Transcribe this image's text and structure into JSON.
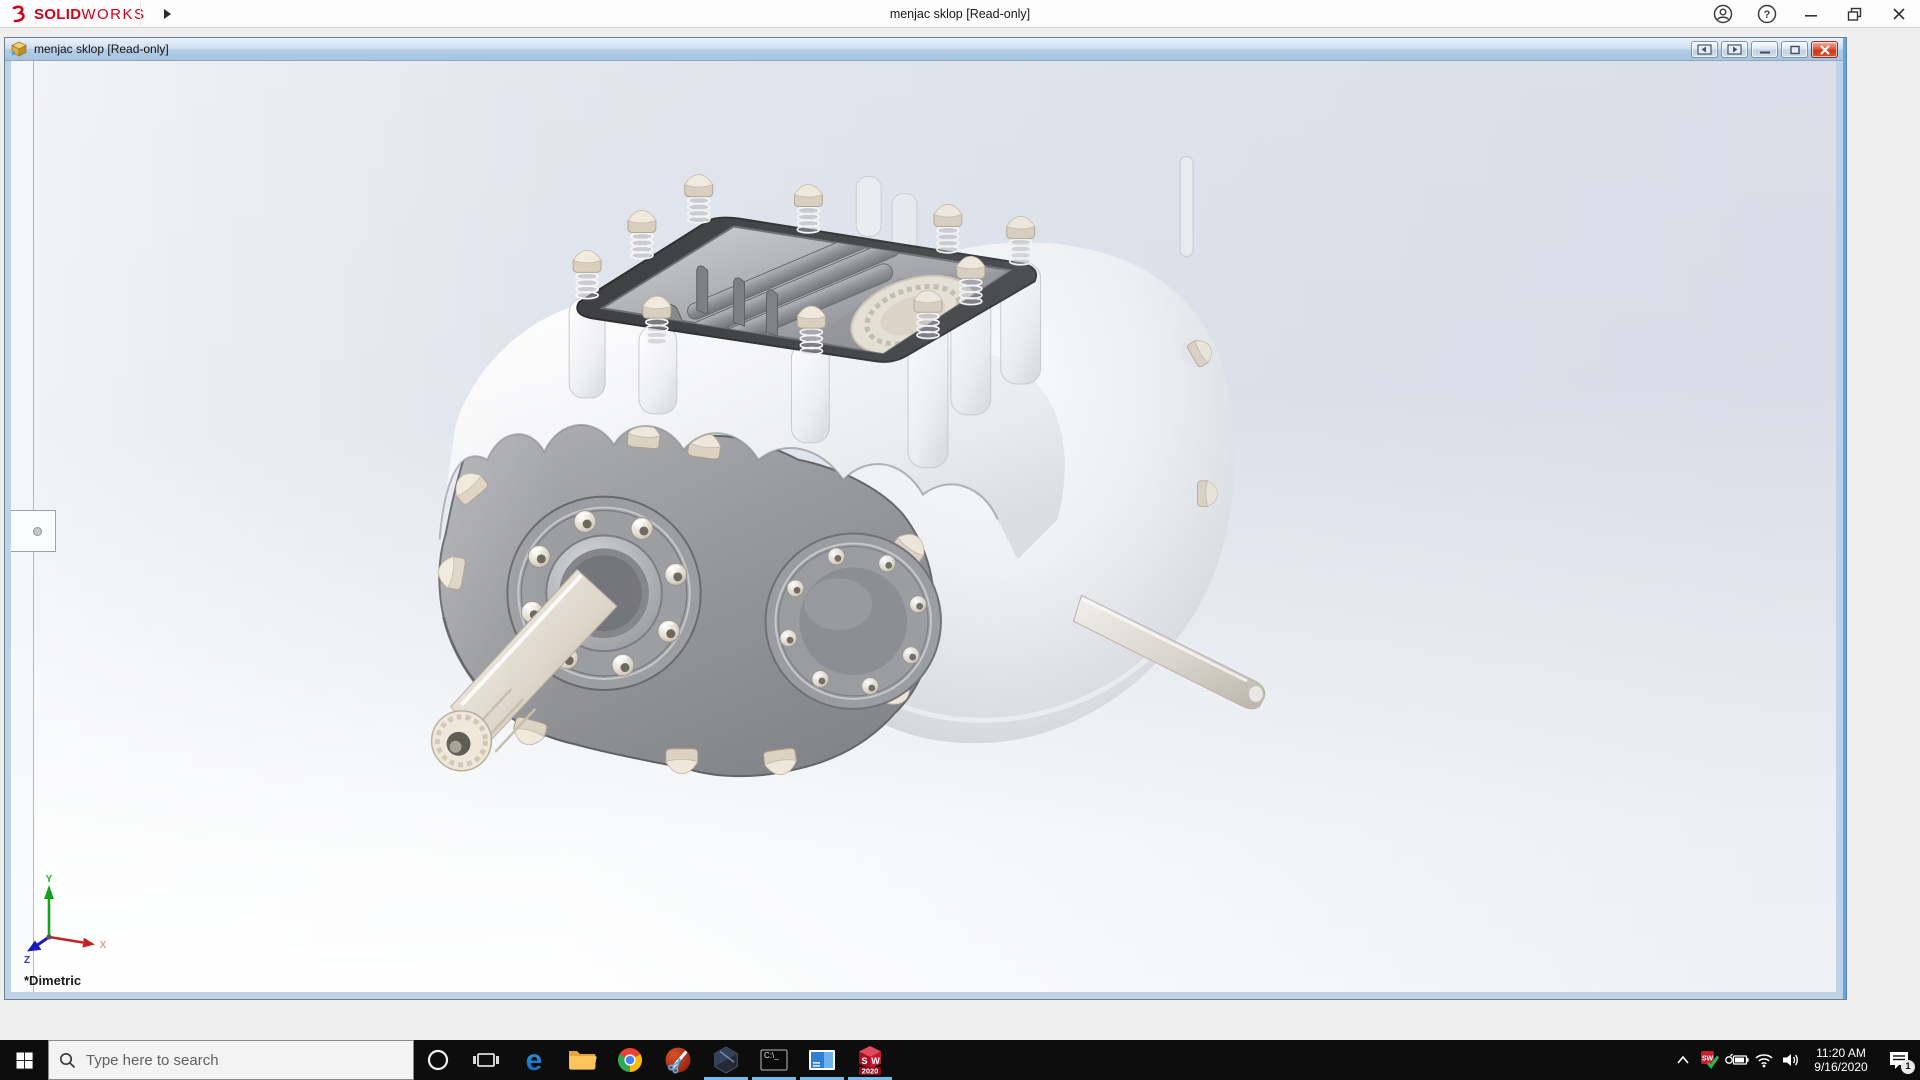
{
  "app": {
    "title": "menjac sklop [Read-only]",
    "brand": {
      "mark": "3S",
      "solid": "SOLID",
      "works": "WORKS"
    },
    "controls": {
      "help_glyph": "?"
    }
  },
  "document": {
    "title": "menjac sklop [Read-only]",
    "view_orientation": "*Dimetric",
    "triad": {
      "x": "X",
      "y": "Y",
      "z": "Z"
    },
    "model_name": "menjac sklop"
  },
  "taskbar": {
    "search_placeholder": "Type here to search",
    "terminal_icon_text": "C:\\_",
    "sw_icon": {
      "s": "S",
      "w": "W",
      "year": "2020"
    },
    "apps": [
      "cortana",
      "task-view",
      "edge",
      "file-explorer",
      "chrome",
      "screen-capture",
      "cad-viewer",
      "command-prompt",
      "media-player",
      "solidworks-2020"
    ],
    "running_apps": [
      "cad-viewer",
      "command-prompt",
      "media-player",
      "solidworks-2020"
    ],
    "tray": {
      "time": "11:20 AM",
      "date": "9/16/2020",
      "notification_count": "1"
    }
  },
  "colors": {
    "logo_red": "#d0021b",
    "accent_run_indicator": "#76b9ed",
    "doc_title_top": "#eaf3fc",
    "doc_title_bottom": "#a8c4e0",
    "close_red": "#d7502f",
    "taskbar_bg": "#0d0d0d",
    "viewport_top": "#e3e6ed",
    "viewport_bottom": "#ffffff"
  }
}
